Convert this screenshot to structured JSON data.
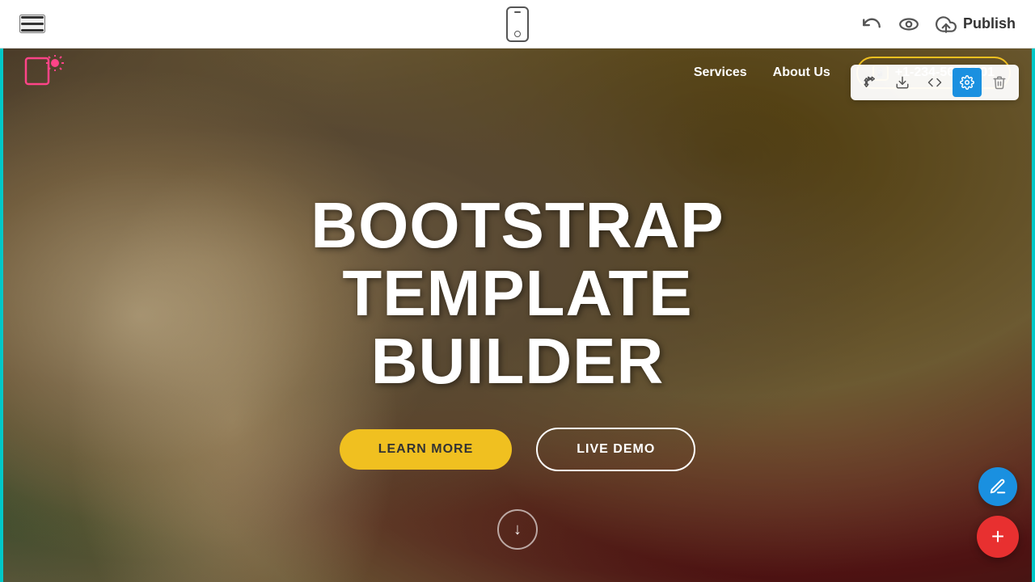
{
  "toolbar": {
    "hamburger_label": "menu",
    "mobile_label": "mobile-view",
    "undo_label": "undo",
    "preview_label": "preview",
    "publish_label": "Publish"
  },
  "nav": {
    "services_label": "Services",
    "about_label": "About Us",
    "phone": "+1-234-567-8901"
  },
  "section_tools": {
    "move_label": "move",
    "download_label": "download",
    "code_label": "code",
    "settings_label": "settings",
    "delete_label": "delete"
  },
  "hero": {
    "title_line1": "BOOTSTRAP",
    "title_line2": "TEMPLATE BUILDER",
    "btn_learn_more": "LEARN MORE",
    "btn_live_demo": "LIVE DEMO"
  },
  "fab": {
    "edit_label": "edit",
    "add_label": "+"
  }
}
